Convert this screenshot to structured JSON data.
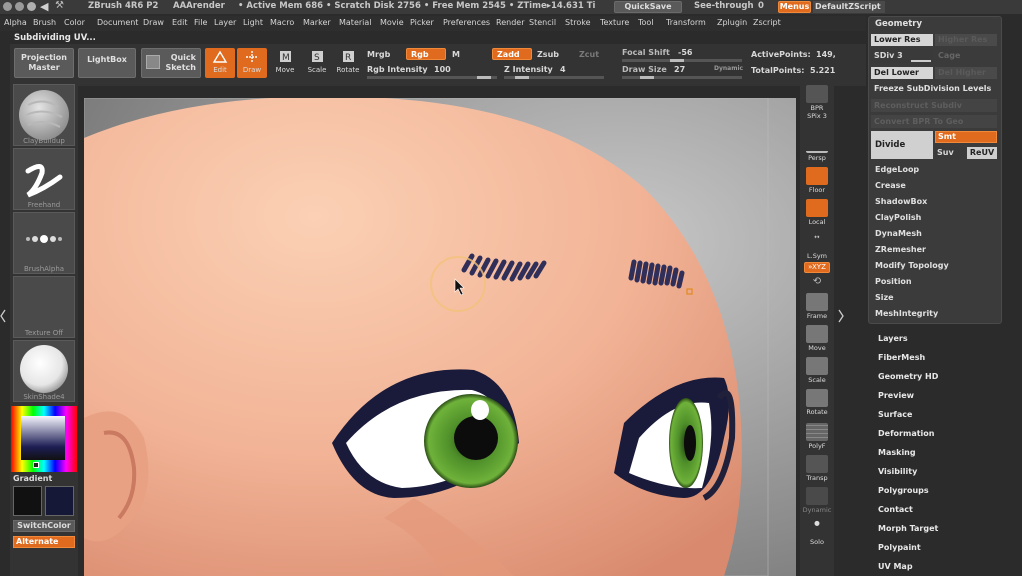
{
  "titlebar": {
    "app": "ZBrush 4R6 P2",
    "render": "AAArender",
    "stats": "• Active Mem 686 • Scratch Disk 2756 • Free Mem 2545 • ZTime▸14.631 Ti",
    "quicksave": "QuickSave",
    "seethrough_label": "See-through",
    "seethrough_value": "0",
    "menus": "Menus",
    "script": "DefaultZScript"
  },
  "menubar": [
    "Alpha",
    "Brush",
    "Color",
    "Document",
    "Draw",
    "Edit",
    "File",
    "Layer",
    "Light",
    "Macro",
    "Marker",
    "Material",
    "Movie",
    "Picker",
    "Preferences",
    "Render",
    "Stencil",
    "Stroke",
    "Texture",
    "Tool",
    "Transform",
    "Zplugin",
    "Zscript"
  ],
  "status": "Subdividing UV...",
  "shelf": {
    "projection_master": [
      "Projection",
      "Master"
    ],
    "lightbox": "LightBox",
    "quick_sketch": [
      "Quick",
      "Sketch"
    ],
    "tools": {
      "edit": "Edit",
      "draw": "Draw",
      "move": "Move",
      "scale": "Scale",
      "rotate": "Rotate"
    },
    "mrgb": "Mrgb",
    "rgb": "Rgb",
    "m": "M",
    "rgb_intensity_label": "Rgb Intensity",
    "rgb_intensity_value": "100",
    "zadd": "Zadd",
    "zsub": "Zsub",
    "zcut": "Zcut",
    "z_intensity_label": "Z Intensity",
    "z_intensity_value": "4",
    "focal_shift_label": "Focal Shift",
    "focal_shift_value": "-56",
    "draw_size_label": "Draw Size",
    "draw_size_value": "27",
    "dynamic": "Dynamic",
    "active_points_label": "ActivePoints:",
    "active_points_value": "149,",
    "total_points_label": "TotalPoints:",
    "total_points_value": "5.221"
  },
  "left_tray": {
    "brush": "ClayBuildup",
    "stroke": "Freehand",
    "alpha": "BrushAlpha",
    "texture": "Texture Off",
    "material": "SkinShade4",
    "gradient": "Gradient",
    "switch_color": "SwitchColor",
    "alternate": "Alternate"
  },
  "right_column": {
    "bpr": "BPR",
    "spix_label": "SPix",
    "spix_value": "3",
    "persp": "Persp",
    "floor": "Floor",
    "local": "Local",
    "lsym": "L.Sym",
    "xyz": "»XYZ",
    "frame": "Frame",
    "move": "Move",
    "scale": "Scale",
    "rotate": "Rotate",
    "polyf": "PolyF",
    "transp": "Transp",
    "dynamic": "Dynamic",
    "solo": "Solo"
  },
  "geometry": {
    "title": "Geometry",
    "lower_res": "Lower Res",
    "higher_res": "Higher Res",
    "sdiv_label": "SDiv",
    "sdiv_value": "3",
    "cage": "Cage",
    "del_lower": "Del Lower",
    "del_higher": "Del Higher",
    "freeze": "Freeze SubDivision Levels",
    "reconstruct": "Reconstruct Subdiv",
    "convert": "Convert BPR To Geo",
    "divide": "Divide",
    "smt": "Smt",
    "suv": "Suv",
    "reuv": "ReUV",
    "items": [
      "EdgeLoop",
      "Crease",
      "ShadowBox",
      "ClayPolish",
      "DynaMesh",
      "ZRemesher",
      "Modify Topology",
      "Position",
      "Size",
      "MeshIntegrity"
    ]
  },
  "palettes": [
    "Layers",
    "FiberMesh",
    "Geometry HD",
    "Preview",
    "Surface",
    "Deformation",
    "Masking",
    "Visibility",
    "Polygroups",
    "Contact",
    "Morph Target",
    "Polypaint",
    "UV Map"
  ],
  "colors": {
    "accent": "#e06a1e",
    "panel": "#3b3b3b",
    "skin": "#f2b396",
    "iris": "#4f8f2a"
  }
}
